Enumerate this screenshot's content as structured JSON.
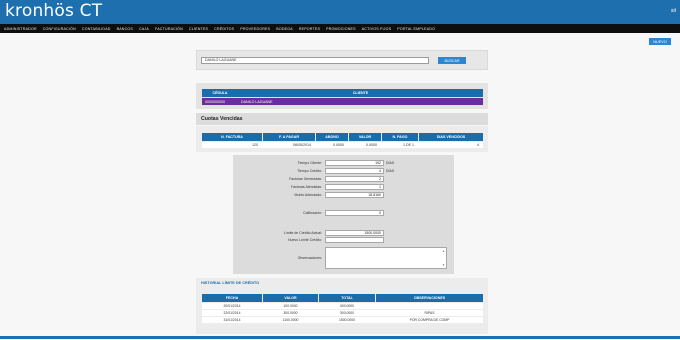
{
  "header": {
    "brand": "kronhös CT",
    "right_text": "sit"
  },
  "nav": [
    "ADMINISTRADOR",
    "CONFIGURACIÓN",
    "CONTABILIDAD",
    "BANCOS",
    "CAJA",
    "FACTURACIÓN",
    "CLIENTES",
    "CRÉDITOS",
    "PROVEEDORES",
    "BODEGA",
    "REPORTES",
    "PROMOCIONES",
    "ACTIVOS FIJOS",
    "PORTAL EMPLEADO"
  ],
  "actions": {
    "nuevo": "NUEVO"
  },
  "search": {
    "value": "DANILO LAGUANE",
    "button": "BUSCAR"
  },
  "client": {
    "headers": [
      "CÉDULA",
      "CLIENTE"
    ],
    "cedula": "0000000000",
    "nombre": "DANILO LAGUANE"
  },
  "cuotas": {
    "title": "Cuotas Vencidas",
    "headers": [
      "N. FACTURA",
      "F. A PAGAR",
      "ABONO",
      "VALOR",
      "N. PAGO",
      "DIAS VENCIDOS"
    ],
    "rows": [
      [
        "120",
        "08/05/2014",
        "0.0000",
        "0.0000",
        "1 DE 1",
        "4"
      ]
    ]
  },
  "form": {
    "fields": [
      {
        "label": "Tiempo Cliente:",
        "value": "192",
        "suffix": "DÍAS"
      },
      {
        "label": "Tiempo Crédito:",
        "value": "4",
        "suffix": "DÍAS"
      },
      {
        "label": "Facturas Generadas:",
        "value": "2",
        "suffix": ""
      },
      {
        "label": "Facturas Atendidas:",
        "value": "1",
        "suffix": ""
      },
      {
        "label": "Monto Adeudado:",
        "value": "18.8160",
        "suffix": ""
      },
      {
        "label": "Calificación:",
        "value": "0",
        "suffix": ""
      },
      {
        "label": "Límite de Crédito Actual:",
        "value": "1500.0000",
        "suffix": ""
      },
      {
        "label": "Nuevo Límite Crédito:",
        "value": "",
        "suffix": ""
      },
      {
        "label": "Observaciones:",
        "value": "",
        "suffix": ""
      }
    ]
  },
  "historial": {
    "title": "HISTORIAL LÍMITE DE CRÉDITO",
    "headers": [
      "FECHA",
      "VALOR",
      "TOTAL",
      "OBSERVACIONES"
    ],
    "rows": [
      [
        "20/01/2014",
        "100.0000",
        "400.0000",
        ""
      ],
      [
        "22/01/2014",
        "300.0000",
        "300.0000",
        "RIPAS"
      ],
      [
        "31/01/2014",
        "1100.0000",
        "1500.0000",
        "POR COMPRA DE COMP"
      ]
    ]
  },
  "colors": {
    "header": "#1d6fae",
    "table_header": "#1b6da9",
    "client_row": "#6b2d9b",
    "button": "#2d86d2"
  }
}
